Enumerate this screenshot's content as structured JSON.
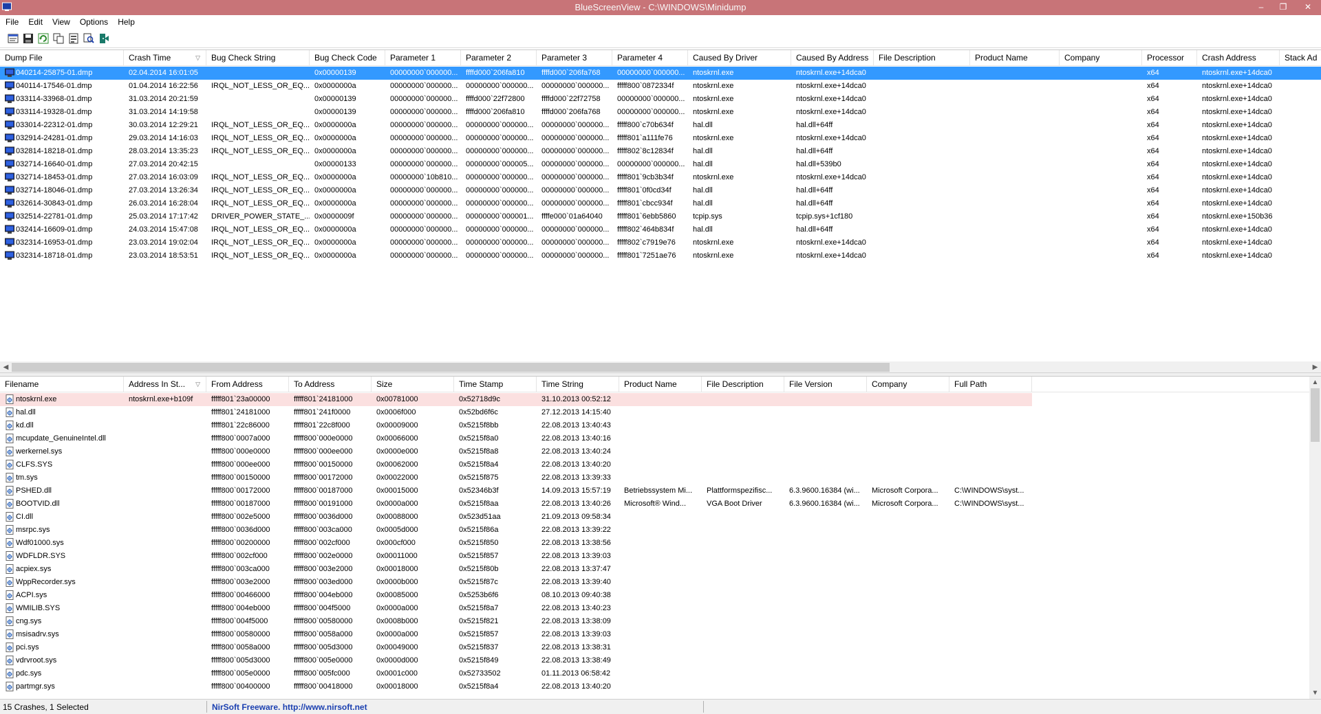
{
  "window": {
    "title": "BlueScreenView  -  C:\\WINDOWS\\Minidump",
    "minimize": "–",
    "maximize": "❐",
    "close": "✕"
  },
  "menu": [
    "File",
    "Edit",
    "View",
    "Options",
    "Help"
  ],
  "toolbar": [
    "properties-icon",
    "save-icon",
    "refresh-icon",
    "copy-icon",
    "report-icon",
    "find-icon",
    "exit-icon"
  ],
  "crash_list": {
    "columns": [
      "Dump File",
      "Crash Time",
      "Bug Check String",
      "Bug Check Code",
      "Parameter 1",
      "Parameter 2",
      "Parameter 3",
      "Parameter 4",
      "Caused By Driver",
      "Caused By Address",
      "File Description",
      "Product Name",
      "Company",
      "Processor",
      "Crash Address",
      "Stack Ad"
    ],
    "sorted_column": "Crash Time",
    "rows": [
      [
        "040214-25875-01.dmp",
        "02.04.2014 16:01:05",
        "",
        "0x00000139",
        "00000000`000000...",
        "ffffd000`206fa810",
        "ffffd000`206fa768",
        "00000000`000000...",
        "ntoskrnl.exe",
        "ntoskrnl.exe+14dca0",
        "",
        "",
        "",
        "x64",
        "ntoskrnl.exe+14dca0",
        ""
      ],
      [
        "040114-17546-01.dmp",
        "01.04.2014 16:22:56",
        "IRQL_NOT_LESS_OR_EQ...",
        "0x0000000a",
        "00000000`000000...",
        "00000000`000000...",
        "00000000`000000...",
        "fffff800`0872334f",
        "ntoskrnl.exe",
        "ntoskrnl.exe+14dca0",
        "",
        "",
        "",
        "x64",
        "ntoskrnl.exe+14dca0",
        ""
      ],
      [
        "033114-33968-01.dmp",
        "31.03.2014 20:21:59",
        "",
        "0x00000139",
        "00000000`000000...",
        "ffffd000`22f72800",
        "ffffd000`22f72758",
        "00000000`000000...",
        "ntoskrnl.exe",
        "ntoskrnl.exe+14dca0",
        "",
        "",
        "",
        "x64",
        "ntoskrnl.exe+14dca0",
        ""
      ],
      [
        "033114-19328-01.dmp",
        "31.03.2014 14:19:58",
        "",
        "0x00000139",
        "00000000`000000...",
        "ffffd000`206fa810",
        "ffffd000`206fa768",
        "00000000`000000...",
        "ntoskrnl.exe",
        "ntoskrnl.exe+14dca0",
        "",
        "",
        "",
        "x64",
        "ntoskrnl.exe+14dca0",
        ""
      ],
      [
        "033014-22312-01.dmp",
        "30.03.2014 12:29:21",
        "IRQL_NOT_LESS_OR_EQ...",
        "0x0000000a",
        "00000000`000000...",
        "00000000`000000...",
        "00000000`000000...",
        "fffff800`c70b634f",
        "hal.dll",
        "hal.dll+64ff",
        "",
        "",
        "",
        "x64",
        "ntoskrnl.exe+14dca0",
        ""
      ],
      [
        "032914-24281-01.dmp",
        "29.03.2014 14:16:03",
        "IRQL_NOT_LESS_OR_EQ...",
        "0x0000000a",
        "00000000`000000...",
        "00000000`000000...",
        "00000000`000000...",
        "fffff801`a111fe76",
        "ntoskrnl.exe",
        "ntoskrnl.exe+14dca0",
        "",
        "",
        "",
        "x64",
        "ntoskrnl.exe+14dca0",
        ""
      ],
      [
        "032814-18218-01.dmp",
        "28.03.2014 13:35:23",
        "IRQL_NOT_LESS_OR_EQ...",
        "0x0000000a",
        "00000000`000000...",
        "00000000`000000...",
        "00000000`000000...",
        "fffff802`8c12834f",
        "hal.dll",
        "hal.dll+64ff",
        "",
        "",
        "",
        "x64",
        "ntoskrnl.exe+14dca0",
        ""
      ],
      [
        "032714-16640-01.dmp",
        "27.03.2014 20:42:15",
        "",
        "0x00000133",
        "00000000`000000...",
        "00000000`000005...",
        "00000000`000000...",
        "00000000`000000...",
        "hal.dll",
        "hal.dll+539b0",
        "",
        "",
        "",
        "x64",
        "ntoskrnl.exe+14dca0",
        ""
      ],
      [
        "032714-18453-01.dmp",
        "27.03.2014 16:03:09",
        "IRQL_NOT_LESS_OR_EQ...",
        "0x0000000a",
        "00000000`10b810...",
        "00000000`000000...",
        "00000000`000000...",
        "fffff801`9cb3b34f",
        "ntoskrnl.exe",
        "ntoskrnl.exe+14dca0",
        "",
        "",
        "",
        "x64",
        "ntoskrnl.exe+14dca0",
        ""
      ],
      [
        "032714-18046-01.dmp",
        "27.03.2014 13:26:34",
        "IRQL_NOT_LESS_OR_EQ...",
        "0x0000000a",
        "00000000`000000...",
        "00000000`000000...",
        "00000000`000000...",
        "fffff801`0f0cd34f",
        "hal.dll",
        "hal.dll+64ff",
        "",
        "",
        "",
        "x64",
        "ntoskrnl.exe+14dca0",
        ""
      ],
      [
        "032614-30843-01.dmp",
        "26.03.2014 16:28:04",
        "IRQL_NOT_LESS_OR_EQ...",
        "0x0000000a",
        "00000000`000000...",
        "00000000`000000...",
        "00000000`000000...",
        "fffff801`cbcc934f",
        "hal.dll",
        "hal.dll+64ff",
        "",
        "",
        "",
        "x64",
        "ntoskrnl.exe+14dca0",
        ""
      ],
      [
        "032514-22781-01.dmp",
        "25.03.2014 17:17:42",
        "DRIVER_POWER_STATE_...",
        "0x0000009f",
        "00000000`000000...",
        "00000000`000001...",
        "ffffe000`01a64040",
        "fffff801`6ebb5860",
        "tcpip.sys",
        "tcpip.sys+1cf180",
        "",
        "",
        "",
        "x64",
        "ntoskrnl.exe+150b36",
        ""
      ],
      [
        "032414-16609-01.dmp",
        "24.03.2014 15:47:08",
        "IRQL_NOT_LESS_OR_EQ...",
        "0x0000000a",
        "00000000`000000...",
        "00000000`000000...",
        "00000000`000000...",
        "fffff802`464b834f",
        "hal.dll",
        "hal.dll+64ff",
        "",
        "",
        "",
        "x64",
        "ntoskrnl.exe+14dca0",
        ""
      ],
      [
        "032314-16953-01.dmp",
        "23.03.2014 19:02:04",
        "IRQL_NOT_LESS_OR_EQ...",
        "0x0000000a",
        "00000000`000000...",
        "00000000`000000...",
        "00000000`000000...",
        "fffff802`c7919e76",
        "ntoskrnl.exe",
        "ntoskrnl.exe+14dca0",
        "",
        "",
        "",
        "x64",
        "ntoskrnl.exe+14dca0",
        ""
      ],
      [
        "032314-18718-01.dmp",
        "23.03.2014 18:53:51",
        "IRQL_NOT_LESS_OR_EQ...",
        "0x0000000a",
        "00000000`000000...",
        "00000000`000000...",
        "00000000`000000...",
        "fffff801`7251ae76",
        "ntoskrnl.exe",
        "ntoskrnl.exe+14dca0",
        "",
        "",
        "",
        "x64",
        "ntoskrnl.exe+14dca0",
        ""
      ]
    ],
    "selected_row": 0
  },
  "driver_list": {
    "columns": [
      "Filename",
      "Address In St...",
      "From Address",
      "To Address",
      "Size",
      "Time Stamp",
      "Time String",
      "Product Name",
      "File Description",
      "File Version",
      "Company",
      "Full Path"
    ],
    "sorted_column": "Address In St...",
    "rows": [
      [
        "ntoskrnl.exe",
        "ntoskrnl.exe+b109f",
        "fffff801`23a00000",
        "fffff801`24181000",
        "0x00781000",
        "0x52718d9c",
        "31.10.2013 00:52:12",
        "",
        "",
        "",
        "",
        ""
      ],
      [
        "hal.dll",
        "",
        "fffff801`24181000",
        "fffff801`241f0000",
        "0x0006f000",
        "0x52bd6f6c",
        "27.12.2013 14:15:40",
        "",
        "",
        "",
        "",
        ""
      ],
      [
        "kd.dll",
        "",
        "fffff801`22c86000",
        "fffff801`22c8f000",
        "0x00009000",
        "0x5215f8bb",
        "22.08.2013 13:40:43",
        "",
        "",
        "",
        "",
        ""
      ],
      [
        "mcupdate_GenuineIntel.dll",
        "",
        "fffff800`0007a000",
        "fffff800`000e0000",
        "0x00066000",
        "0x5215f8a0",
        "22.08.2013 13:40:16",
        "",
        "",
        "",
        "",
        ""
      ],
      [
        "werkernel.sys",
        "",
        "fffff800`000e0000",
        "fffff800`000ee000",
        "0x0000e000",
        "0x5215f8a8",
        "22.08.2013 13:40:24",
        "",
        "",
        "",
        "",
        ""
      ],
      [
        "CLFS.SYS",
        "",
        "fffff800`000ee000",
        "fffff800`00150000",
        "0x00062000",
        "0x5215f8a4",
        "22.08.2013 13:40:20",
        "",
        "",
        "",
        "",
        ""
      ],
      [
        "tm.sys",
        "",
        "fffff800`00150000",
        "fffff800`00172000",
        "0x00022000",
        "0x5215f875",
        "22.08.2013 13:39:33",
        "",
        "",
        "",
        "",
        ""
      ],
      [
        "PSHED.dll",
        "",
        "fffff800`00172000",
        "fffff800`00187000",
        "0x00015000",
        "0x52346b3f",
        "14.09.2013 15:57:19",
        "Betriebssystem Mi...",
        "Plattformspezifisc...",
        "6.3.9600.16384 (wi...",
        "Microsoft Corpora...",
        "C:\\WINDOWS\\syst..."
      ],
      [
        "BOOTVID.dll",
        "",
        "fffff800`00187000",
        "fffff800`00191000",
        "0x0000a000",
        "0x5215f8aa",
        "22.08.2013 13:40:26",
        "Microsoft® Wind...",
        "VGA Boot Driver",
        "6.3.9600.16384 (wi...",
        "Microsoft Corpora...",
        "C:\\WINDOWS\\syst..."
      ],
      [
        "CI.dll",
        "",
        "fffff800`002e5000",
        "fffff800`0036d000",
        "0x00088000",
        "0x523d51aa",
        "21.09.2013 09:58:34",
        "",
        "",
        "",
        "",
        ""
      ],
      [
        "msrpc.sys",
        "",
        "fffff800`0036d000",
        "fffff800`003ca000",
        "0x0005d000",
        "0x5215f86a",
        "22.08.2013 13:39:22",
        "",
        "",
        "",
        "",
        ""
      ],
      [
        "Wdf01000.sys",
        "",
        "fffff800`00200000",
        "fffff800`002cf000",
        "0x000cf000",
        "0x5215f850",
        "22.08.2013 13:38:56",
        "",
        "",
        "",
        "",
        ""
      ],
      [
        "WDFLDR.SYS",
        "",
        "fffff800`002cf000",
        "fffff800`002e0000",
        "0x00011000",
        "0x5215f857",
        "22.08.2013 13:39:03",
        "",
        "",
        "",
        "",
        ""
      ],
      [
        "acpiex.sys",
        "",
        "fffff800`003ca000",
        "fffff800`003e2000",
        "0x00018000",
        "0x5215f80b",
        "22.08.2013 13:37:47",
        "",
        "",
        "",
        "",
        ""
      ],
      [
        "WppRecorder.sys",
        "",
        "fffff800`003e2000",
        "fffff800`003ed000",
        "0x0000b000",
        "0x5215f87c",
        "22.08.2013 13:39:40",
        "",
        "",
        "",
        "",
        ""
      ],
      [
        "ACPI.sys",
        "",
        "fffff800`00466000",
        "fffff800`004eb000",
        "0x00085000",
        "0x5253b6f6",
        "08.10.2013 09:40:38",
        "",
        "",
        "",
        "",
        ""
      ],
      [
        "WMILIB.SYS",
        "",
        "fffff800`004eb000",
        "fffff800`004f5000",
        "0x0000a000",
        "0x5215f8a7",
        "22.08.2013 13:40:23",
        "",
        "",
        "",
        "",
        ""
      ],
      [
        "cng.sys",
        "",
        "fffff800`004f5000",
        "fffff800`00580000",
        "0x0008b000",
        "0x5215f821",
        "22.08.2013 13:38:09",
        "",
        "",
        "",
        "",
        ""
      ],
      [
        "msisadrv.sys",
        "",
        "fffff800`00580000",
        "fffff800`0058a000",
        "0x0000a000",
        "0x5215f857",
        "22.08.2013 13:39:03",
        "",
        "",
        "",
        "",
        ""
      ],
      [
        "pci.sys",
        "",
        "fffff800`0058a000",
        "fffff800`005d3000",
        "0x00049000",
        "0x5215f837",
        "22.08.2013 13:38:31",
        "",
        "",
        "",
        "",
        ""
      ],
      [
        "vdrvroot.sys",
        "",
        "fffff800`005d3000",
        "fffff800`005e0000",
        "0x0000d000",
        "0x5215f849",
        "22.08.2013 13:38:49",
        "",
        "",
        "",
        "",
        ""
      ],
      [
        "pdc.sys",
        "",
        "fffff800`005e0000",
        "fffff800`005fc000",
        "0x0001c000",
        "0x52733502",
        "01.11.2013 06:58:42",
        "",
        "",
        "",
        "",
        ""
      ],
      [
        "partmgr.sys",
        "",
        "fffff800`00400000",
        "fffff800`00418000",
        "0x00018000",
        "0x5215f8a4",
        "22.08.2013 13:40:20",
        "",
        "",
        "",
        "",
        ""
      ]
    ],
    "highlight_row": 0
  },
  "status": {
    "summary": "15 Crashes, 1 Selected",
    "link": "NirSoft Freeware.  http://www.nirsoft.net"
  },
  "colors": {
    "titlebar": "#c87478",
    "selection": "#3399ff",
    "highlight": "#fbe0e0",
    "link": "#1a3fb0"
  }
}
